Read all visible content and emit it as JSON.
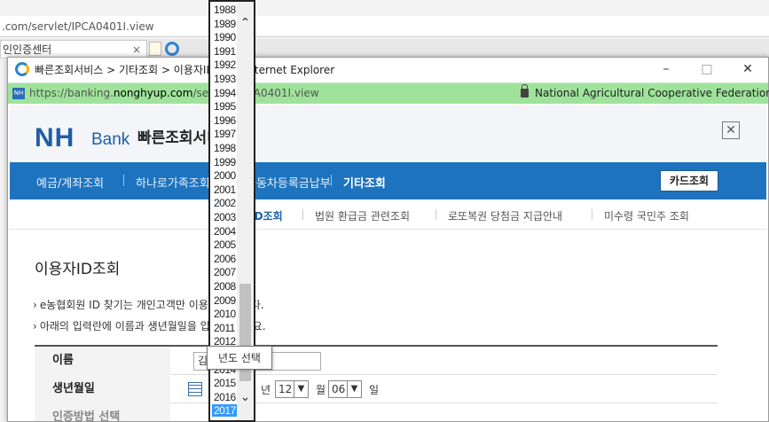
{
  "bg_browser": {
    "url": ".com/servlet/IPCA0401I.view",
    "tab_label": "인인증센터",
    "tab_close": "×"
  },
  "popup": {
    "title": "빠른조회서비스 > 기타조회 > 이용자ID조회 - Internet Explorer",
    "minimize": "–",
    "maximize": "□",
    "close": "✕",
    "nh_badge": "NH",
    "url_prefix": "https://banking.",
    "url_domain": "nonghyup.com",
    "url_rest": "/servlet/IPCA0401I.view",
    "security_org": "National Agricultural Cooperative Federation [..."
  },
  "header": {
    "logo_nh": "NH",
    "logo_bank": "Bank",
    "service_name": "빠른조회서비스",
    "close_label": "✕"
  },
  "nav": {
    "items": [
      "예금/계좌조회",
      "하나로가족조회",
      "자동차등록금납부",
      "기타조회"
    ],
    "card_button": "카드조회"
  },
  "subnav": {
    "items": [
      "이용자ID조회",
      "법원 환급금 관련조회",
      "로또복권 당첨금 지급안내",
      "미수령 국민주 조회"
    ]
  },
  "content": {
    "page_title": "이용자ID조회",
    "notice_1": "e농협회원 ID 찾기는 개인고객만 이용 가능합니다.",
    "notice_2": "아래의 입력란에 이름과 생년월일을 입력해 주세요."
  },
  "form": {
    "name_label": "이름",
    "name_value": "김",
    "birth_label": "생년월일",
    "year_unit": "년",
    "month_value": "12",
    "month_unit": "월",
    "day_value": "06",
    "day_unit": "일",
    "row3_label": "인증방법 선택"
  },
  "year_dropdown": {
    "options": [
      "1988",
      "1989",
      "1990",
      "1991",
      "1992",
      "1993",
      "1994",
      "1995",
      "1996",
      "1997",
      "1998",
      "1999",
      "2000",
      "2001",
      "2002",
      "2003",
      "2004",
      "2005",
      "2006",
      "2007",
      "2008",
      "2009",
      "2010",
      "2011",
      "2012",
      "2013",
      "2014",
      "2015",
      "2016",
      "2017"
    ],
    "selected": "2017",
    "tooltip": "년도 선택"
  }
}
